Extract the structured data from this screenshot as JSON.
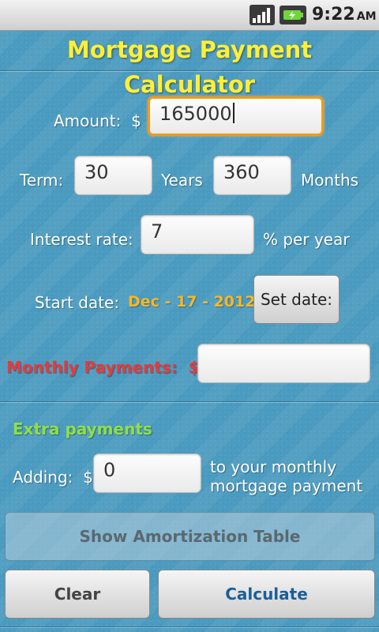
{
  "status_bar": {
    "time": "9:22",
    "ampm": "AM"
  },
  "app": {
    "title": "Mortgage Payment Calculator"
  },
  "amount": {
    "label": "Amount:",
    "currency": "$",
    "value": "165000"
  },
  "term": {
    "label": "Term:",
    "years_value": "30",
    "years_label": "Years",
    "months_value": "360",
    "months_label": "Months"
  },
  "interest": {
    "label": "Interest rate:",
    "value": "7",
    "unit": "% per year"
  },
  "start_date": {
    "label": "Start date:",
    "value": "Dec - 17 - 2012",
    "button": "Set date:"
  },
  "monthly": {
    "label": "Monthly Payments:",
    "currency": "$",
    "value": ""
  },
  "extra": {
    "header": "Extra payments",
    "adding_label": "Adding:",
    "currency": "$",
    "value": "0",
    "desc_line1": "to your monthly",
    "desc_line2": "mortgage payment"
  },
  "buttons": {
    "amortization": "Show Amortization Table",
    "clear": "Clear",
    "calculate": "Calculate"
  },
  "colors": {
    "title": "#ffef35",
    "background": "#4b9bc0",
    "date": "#f7b72a",
    "monthly_label": "#e73a3a",
    "extra_header": "#8fe045",
    "focus_border": "#f29a1c",
    "calculate_text": "#1a5f99"
  }
}
